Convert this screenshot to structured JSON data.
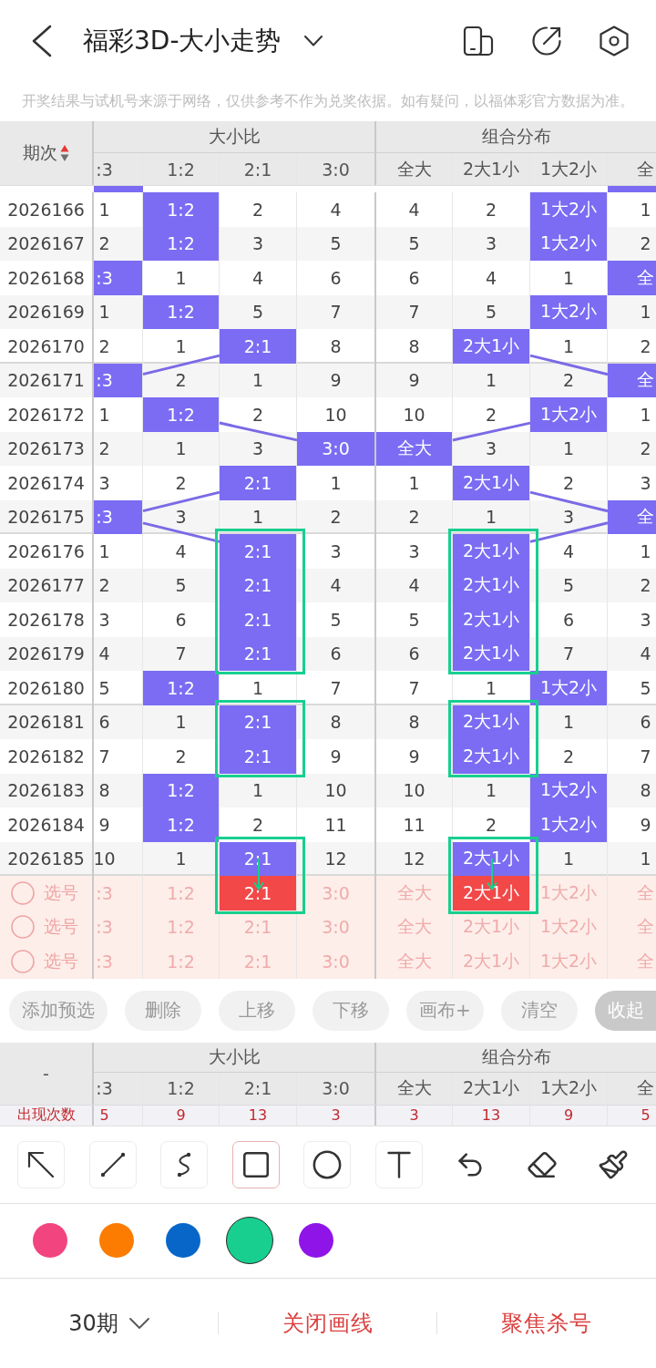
{
  "top_bar": {
    "title": "福彩3D-大小走势"
  },
  "notice": "开奖结果与试机号来源于网络，仅供参考不作为兑奖依据。如有疑问，以福体彩官方数据为准。",
  "table": {
    "issue_label": "期次",
    "sort_ascending": true,
    "groups": [
      {
        "title": "大小比",
        "columns": [
          ":3",
          "1:2",
          "2:1",
          "3:0"
        ]
      },
      {
        "title": "组合分布",
        "columns": [
          "全大",
          "2大1小",
          "1大2小",
          "全"
        ]
      }
    ],
    "cut_row": {
      "ratio": [
        {
          "hit": true
        },
        {
          "hit": false
        },
        {
          "hit": false
        },
        {
          "hit": false
        }
      ],
      "combo": [
        {
          "hit": false
        },
        {
          "hit": false
        },
        {
          "hit": false
        },
        {
          "hit": true
        }
      ]
    },
    "rows": [
      {
        "issue": "2026166",
        "ratio": [
          {
            "text": "1",
            "hit": false
          },
          {
            "text": "1:2",
            "hit": true
          },
          {
            "text": "2",
            "hit": false
          },
          {
            "text": "4",
            "hit": false
          }
        ],
        "combo": [
          {
            "text": "4",
            "hit": false
          },
          {
            "text": "2",
            "hit": false
          },
          {
            "text": "1大2小",
            "hit": true
          },
          {
            "text": "1",
            "hit": false
          }
        ]
      },
      {
        "issue": "2026167",
        "ratio": [
          {
            "text": "2",
            "hit": false
          },
          {
            "text": "1:2",
            "hit": true
          },
          {
            "text": "3",
            "hit": false
          },
          {
            "text": "5",
            "hit": false
          }
        ],
        "combo": [
          {
            "text": "5",
            "hit": false
          },
          {
            "text": "3",
            "hit": false
          },
          {
            "text": "1大2小",
            "hit": true
          },
          {
            "text": "2",
            "hit": false
          }
        ]
      },
      {
        "issue": "2026168",
        "ratio": [
          {
            "text": ":3",
            "hit": true
          },
          {
            "text": "1",
            "hit": false
          },
          {
            "text": "4",
            "hit": false
          },
          {
            "text": "6",
            "hit": false
          }
        ],
        "combo": [
          {
            "text": "6",
            "hit": false
          },
          {
            "text": "4",
            "hit": false
          },
          {
            "text": "1",
            "hit": false
          },
          {
            "text": "全",
            "hit": true
          }
        ]
      },
      {
        "issue": "2026169",
        "ratio": [
          {
            "text": "1",
            "hit": false
          },
          {
            "text": "1:2",
            "hit": true
          },
          {
            "text": "5",
            "hit": false
          },
          {
            "text": "7",
            "hit": false
          }
        ],
        "combo": [
          {
            "text": "7",
            "hit": false
          },
          {
            "text": "5",
            "hit": false
          },
          {
            "text": "1大2小",
            "hit": true
          },
          {
            "text": "1",
            "hit": false
          }
        ]
      },
      {
        "issue": "2026170",
        "ratio": [
          {
            "text": "2",
            "hit": false
          },
          {
            "text": "1",
            "hit": false
          },
          {
            "text": "2:1",
            "hit": true
          },
          {
            "text": "8",
            "hit": false
          }
        ],
        "combo": [
          {
            "text": "8",
            "hit": false
          },
          {
            "text": "2大1小",
            "hit": true
          },
          {
            "text": "1",
            "hit": false
          },
          {
            "text": "2",
            "hit": false
          }
        ]
      },
      {
        "issue": "2026171",
        "ratio": [
          {
            "text": ":3",
            "hit": true
          },
          {
            "text": "2",
            "hit": false
          },
          {
            "text": "1",
            "hit": false
          },
          {
            "text": "9",
            "hit": false
          }
        ],
        "combo": [
          {
            "text": "9",
            "hit": false
          },
          {
            "text": "1",
            "hit": false
          },
          {
            "text": "2",
            "hit": false
          },
          {
            "text": "全",
            "hit": true
          }
        ]
      },
      {
        "issue": "2026172",
        "ratio": [
          {
            "text": "1",
            "hit": false
          },
          {
            "text": "1:2",
            "hit": true
          },
          {
            "text": "2",
            "hit": false
          },
          {
            "text": "10",
            "hit": false
          }
        ],
        "combo": [
          {
            "text": "10",
            "hit": false
          },
          {
            "text": "2",
            "hit": false
          },
          {
            "text": "1大2小",
            "hit": true
          },
          {
            "text": "1",
            "hit": false
          }
        ]
      },
      {
        "issue": "2026173",
        "ratio": [
          {
            "text": "2",
            "hit": false
          },
          {
            "text": "1",
            "hit": false
          },
          {
            "text": "3",
            "hit": false
          },
          {
            "text": "3:0",
            "hit": true
          }
        ],
        "combo": [
          {
            "text": "全大",
            "hit": true
          },
          {
            "text": "3",
            "hit": false
          },
          {
            "text": "1",
            "hit": false
          },
          {
            "text": "2",
            "hit": false
          }
        ]
      },
      {
        "issue": "2026174",
        "ratio": [
          {
            "text": "3",
            "hit": false
          },
          {
            "text": "2",
            "hit": false
          },
          {
            "text": "2:1",
            "hit": true
          },
          {
            "text": "1",
            "hit": false
          }
        ],
        "combo": [
          {
            "text": "1",
            "hit": false
          },
          {
            "text": "2大1小",
            "hit": true
          },
          {
            "text": "2",
            "hit": false
          },
          {
            "text": "3",
            "hit": false
          }
        ]
      },
      {
        "issue": "2026175",
        "ratio": [
          {
            "text": ":3",
            "hit": true
          },
          {
            "text": "3",
            "hit": false
          },
          {
            "text": "1",
            "hit": false
          },
          {
            "text": "2",
            "hit": false
          }
        ],
        "combo": [
          {
            "text": "2",
            "hit": false
          },
          {
            "text": "1",
            "hit": false
          },
          {
            "text": "3",
            "hit": false
          },
          {
            "text": "全",
            "hit": true
          }
        ]
      },
      {
        "issue": "2026176",
        "ratio": [
          {
            "text": "1",
            "hit": false
          },
          {
            "text": "4",
            "hit": false
          },
          {
            "text": "2:1",
            "hit": true,
            "boxed": true
          },
          {
            "text": "3",
            "hit": false
          }
        ],
        "combo": [
          {
            "text": "3",
            "hit": false
          },
          {
            "text": "2大1小",
            "hit": true,
            "boxed": true
          },
          {
            "text": "4",
            "hit": false
          },
          {
            "text": "1",
            "hit": false
          }
        ]
      },
      {
        "issue": "2026177",
        "ratio": [
          {
            "text": "2",
            "hit": false
          },
          {
            "text": "5",
            "hit": false
          },
          {
            "text": "2:1",
            "hit": true,
            "boxed": true
          },
          {
            "text": "4",
            "hit": false
          }
        ],
        "combo": [
          {
            "text": "4",
            "hit": false
          },
          {
            "text": "2大1小",
            "hit": true,
            "boxed": true
          },
          {
            "text": "5",
            "hit": false
          },
          {
            "text": "2",
            "hit": false
          }
        ]
      },
      {
        "issue": "2026178",
        "ratio": [
          {
            "text": "3",
            "hit": false
          },
          {
            "text": "6",
            "hit": false
          },
          {
            "text": "2:1",
            "hit": true,
            "boxed": true
          },
          {
            "text": "5",
            "hit": false
          }
        ],
        "combo": [
          {
            "text": "5",
            "hit": false
          },
          {
            "text": "2大1小",
            "hit": true,
            "boxed": true
          },
          {
            "text": "6",
            "hit": false
          },
          {
            "text": "3",
            "hit": false
          }
        ]
      },
      {
        "issue": "2026179",
        "ratio": [
          {
            "text": "4",
            "hit": false
          },
          {
            "text": "7",
            "hit": false
          },
          {
            "text": "2:1",
            "hit": true,
            "boxed": true
          },
          {
            "text": "6",
            "hit": false
          }
        ],
        "combo": [
          {
            "text": "6",
            "hit": false
          },
          {
            "text": "2大1小",
            "hit": true,
            "boxed": true
          },
          {
            "text": "7",
            "hit": false
          },
          {
            "text": "4",
            "hit": false
          }
        ]
      },
      {
        "issue": "2026180",
        "ratio": [
          {
            "text": "5",
            "hit": false
          },
          {
            "text": "1:2",
            "hit": true
          },
          {
            "text": "1",
            "hit": false
          },
          {
            "text": "7",
            "hit": false
          }
        ],
        "combo": [
          {
            "text": "7",
            "hit": false
          },
          {
            "text": "1",
            "hit": false
          },
          {
            "text": "1大2小",
            "hit": true
          },
          {
            "text": "5",
            "hit": false
          }
        ]
      },
      {
        "issue": "2026181",
        "ratio": [
          {
            "text": "6",
            "hit": false
          },
          {
            "text": "1",
            "hit": false
          },
          {
            "text": "2:1",
            "hit": true,
            "boxed": true
          },
          {
            "text": "8",
            "hit": false
          }
        ],
        "combo": [
          {
            "text": "8",
            "hit": false
          },
          {
            "text": "2大1小",
            "hit": true,
            "boxed": true
          },
          {
            "text": "1",
            "hit": false
          },
          {
            "text": "6",
            "hit": false
          }
        ]
      },
      {
        "issue": "2026182",
        "ratio": [
          {
            "text": "7",
            "hit": false
          },
          {
            "text": "2",
            "hit": false
          },
          {
            "text": "2:1",
            "hit": true,
            "boxed": true
          },
          {
            "text": "9",
            "hit": false
          }
        ],
        "combo": [
          {
            "text": "9",
            "hit": false
          },
          {
            "text": "2大1小",
            "hit": true,
            "boxed": true
          },
          {
            "text": "2",
            "hit": false
          },
          {
            "text": "7",
            "hit": false
          }
        ]
      },
      {
        "issue": "2026183",
        "ratio": [
          {
            "text": "8",
            "hit": false
          },
          {
            "text": "1:2",
            "hit": true
          },
          {
            "text": "1",
            "hit": false
          },
          {
            "text": "10",
            "hit": false
          }
        ],
        "combo": [
          {
            "text": "10",
            "hit": false
          },
          {
            "text": "1",
            "hit": false
          },
          {
            "text": "1大2小",
            "hit": true
          },
          {
            "text": "8",
            "hit": false
          }
        ]
      },
      {
        "issue": "2026184",
        "ratio": [
          {
            "text": "9",
            "hit": false
          },
          {
            "text": "1:2",
            "hit": true
          },
          {
            "text": "2",
            "hit": false
          },
          {
            "text": "11",
            "hit": false
          }
        ],
        "combo": [
          {
            "text": "11",
            "hit": false
          },
          {
            "text": "2",
            "hit": false
          },
          {
            "text": "1大2小",
            "hit": true
          },
          {
            "text": "9",
            "hit": false
          }
        ]
      },
      {
        "issue": "2026185",
        "ratio": [
          {
            "text": "10",
            "hit": false
          },
          {
            "text": "1",
            "hit": false
          },
          {
            "text": "2:1",
            "hit": true,
            "boxed": true,
            "arrow_down": true
          },
          {
            "text": "12",
            "hit": false
          }
        ],
        "combo": [
          {
            "text": "12",
            "hit": false
          },
          {
            "text": "2大1小",
            "hit": true,
            "boxed": true,
            "arrow_down": true
          },
          {
            "text": "1",
            "hit": false
          },
          {
            "text": "1",
            "hit": false
          }
        ]
      }
    ],
    "pick_rows": [
      {
        "label": "选号",
        "checked": false,
        "ratio": [
          {
            "text": ":3",
            "selected": false
          },
          {
            "text": "1:2",
            "selected": false
          },
          {
            "text": "2:1",
            "selected": true,
            "boxed": true
          },
          {
            "text": "3:0",
            "selected": false
          }
        ],
        "combo": [
          {
            "text": "全大",
            "selected": false
          },
          {
            "text": "2大1小",
            "selected": true,
            "boxed": true
          },
          {
            "text": "1大2小",
            "selected": false
          },
          {
            "text": "全",
            "selected": false
          }
        ]
      },
      {
        "label": "选号",
        "checked": false,
        "ratio": [
          {
            "text": ":3",
            "selected": false
          },
          {
            "text": "1:2",
            "selected": false
          },
          {
            "text": "2:1",
            "selected": false
          },
          {
            "text": "3:0",
            "selected": false
          }
        ],
        "combo": [
          {
            "text": "全大",
            "selected": false
          },
          {
            "text": "2大1小",
            "selected": false
          },
          {
            "text": "1大2小",
            "selected": false
          },
          {
            "text": "全",
            "selected": false
          }
        ]
      },
      {
        "label": "选号",
        "checked": false,
        "ratio": [
          {
            "text": ":3",
            "selected": false
          },
          {
            "text": "1:2",
            "selected": false
          },
          {
            "text": "2:1",
            "selected": false
          },
          {
            "text": "3:0",
            "selected": false
          }
        ],
        "combo": [
          {
            "text": "全大",
            "selected": false
          },
          {
            "text": "2大1小",
            "selected": false
          },
          {
            "text": "1大2小",
            "selected": false
          },
          {
            "text": "全",
            "selected": false
          }
        ]
      }
    ]
  },
  "actions": [
    {
      "label": "添加预选",
      "kind": "plain"
    },
    {
      "label": "删除",
      "kind": "plain"
    },
    {
      "label": "上移",
      "kind": "plain"
    },
    {
      "label": "下移",
      "kind": "plain"
    },
    {
      "label": "画布+",
      "kind": "plain"
    },
    {
      "label": "清空",
      "kind": "plain"
    },
    {
      "label": "收起",
      "kind": "collapse"
    }
  ],
  "summary": {
    "issue_label": "-",
    "groups": [
      {
        "title": "大小比",
        "columns": [
          ":3",
          "1:2",
          "2:1",
          "3:0"
        ]
      },
      {
        "title": "组合分布",
        "columns": [
          "全大",
          "2大1小",
          "1大2小",
          "全"
        ]
      }
    ],
    "row_label": "出现次数",
    "ratio": [
      "5",
      "9",
      "13",
      "3"
    ],
    "combo": [
      "3",
      "13",
      "9",
      "5"
    ]
  },
  "tools": [
    {
      "kind": "arrow",
      "selected": false
    },
    {
      "kind": "line",
      "selected": false
    },
    {
      "kind": "curve",
      "selected": false
    },
    {
      "kind": "rect",
      "selected": true
    },
    {
      "kind": "ellipse",
      "selected": false
    },
    {
      "kind": "text",
      "selected": false
    },
    {
      "kind": "undo",
      "selected": false
    },
    {
      "kind": "eraser",
      "selected": false
    },
    {
      "kind": "brush",
      "selected": false
    }
  ],
  "palette": [
    {
      "color": "#f2447e",
      "selected": false
    },
    {
      "color": "#fb7c00",
      "selected": false
    },
    {
      "color": "#0866c8",
      "selected": false
    },
    {
      "color": "#18cf8f",
      "selected": true
    },
    {
      "color": "#8f14e8",
      "selected": false
    }
  ],
  "footer": {
    "period": "30期",
    "actions": [
      "关闭画线",
      "聚焦杀号"
    ]
  }
}
